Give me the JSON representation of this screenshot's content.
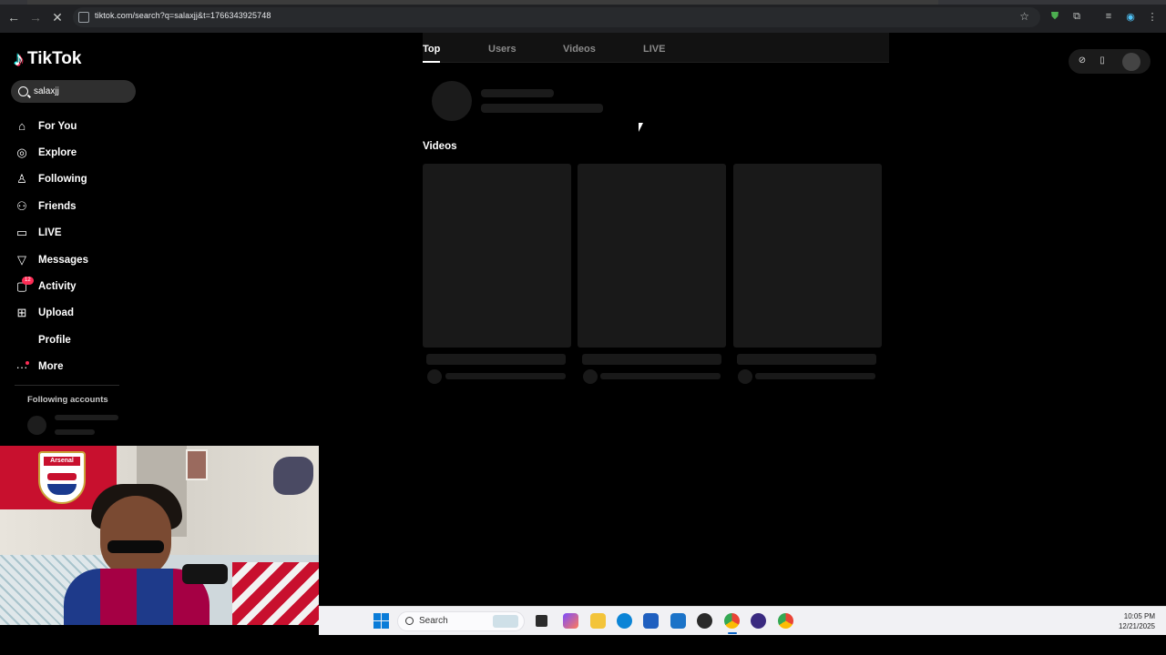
{
  "browser": {
    "url": "tiktok.com/search?q=salaxjj&t=1766343925748",
    "nav_icons": [
      "back-arrow-icon",
      "forward-arrow-icon",
      "reload-icon"
    ]
  },
  "app": {
    "brand": "TikTok"
  },
  "search": {
    "query": "salaxjj"
  },
  "sidebar": {
    "items": [
      {
        "label": "For You",
        "icon": "home-icon"
      },
      {
        "label": "Explore",
        "icon": "compass-icon"
      },
      {
        "label": "Following",
        "icon": "following-icon"
      },
      {
        "label": "Friends",
        "icon": "friends-icon"
      },
      {
        "label": "LIVE",
        "icon": "live-tv-icon"
      },
      {
        "label": "Messages",
        "icon": "messages-icon"
      },
      {
        "label": "Activity",
        "icon": "activity-icon",
        "badge": "12"
      },
      {
        "label": "Upload",
        "icon": "upload-icon"
      },
      {
        "label": "Profile",
        "icon": "profile-icon"
      },
      {
        "label": "More",
        "icon": "more-dots-icon"
      }
    ],
    "following_title": "Following accounts"
  },
  "main": {
    "tabs": [
      {
        "label": "Top",
        "active": true
      },
      {
        "label": "Users",
        "active": false
      },
      {
        "label": "Videos",
        "active": false
      },
      {
        "label": "LIVE",
        "active": false
      }
    ],
    "videos_title": "Videos"
  },
  "webcam": {
    "flag_text": "Arsenal"
  },
  "taskbar": {
    "search_placeholder": "Search",
    "time": "10:05 PM",
    "date": "12/21/2025"
  },
  "colors": {
    "accent": "#fe2c55",
    "cyan": "#25f4ee",
    "background": "#000000",
    "skeleton": "#191919"
  }
}
